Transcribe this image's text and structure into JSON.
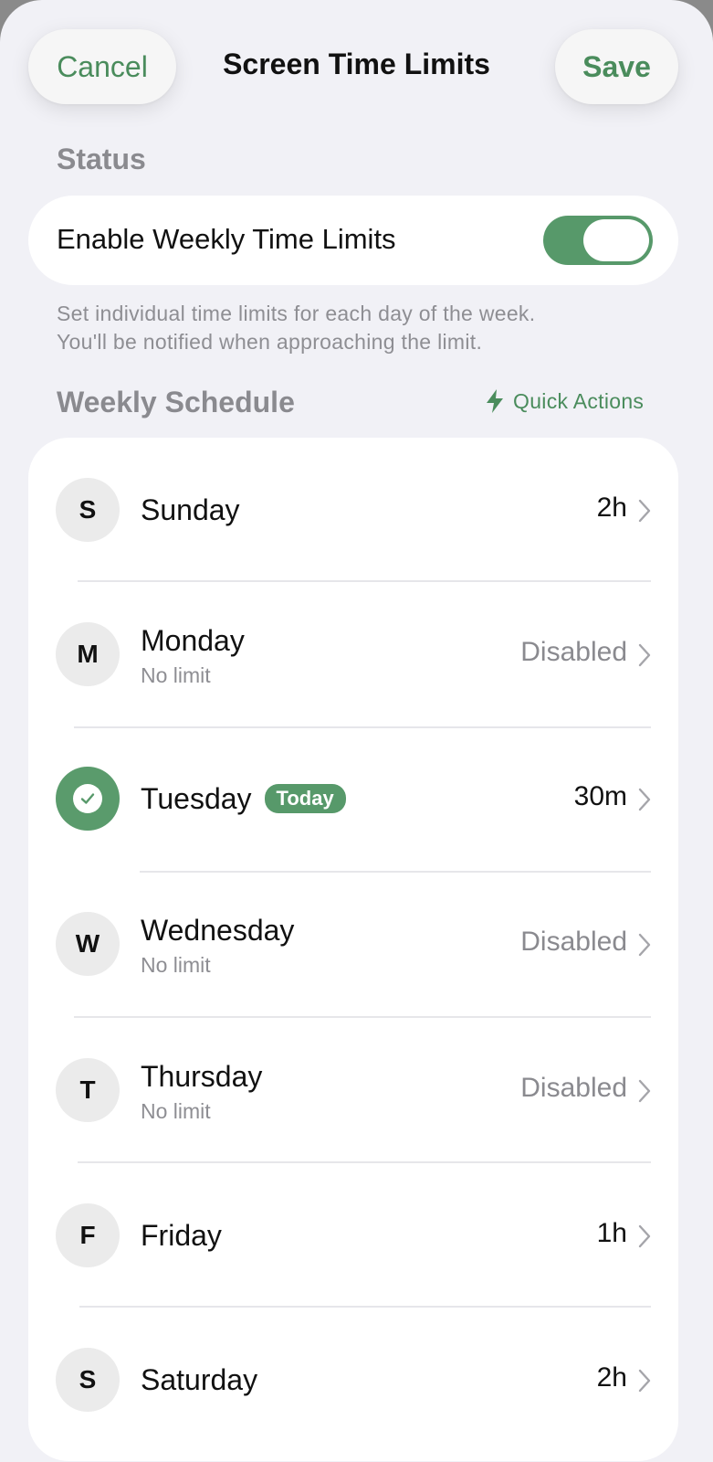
{
  "nav": {
    "cancel_label": "Cancel",
    "title": "Screen Time Limits",
    "save_label": "Save"
  },
  "status": {
    "heading": "Status",
    "toggle_label": "Enable Weekly Time Limits",
    "enabled": true,
    "helper_line1": "Set individual time limits for each day of the week.",
    "helper_line2": "You'll be notified when approaching the limit."
  },
  "schedule": {
    "heading": "Weekly Schedule",
    "quick_actions_label": "Quick Actions",
    "today_badge": "Today",
    "days": [
      {
        "initial": "S",
        "name": "Sunday",
        "sub": "",
        "value": "2h",
        "disabled": false,
        "today": false
      },
      {
        "initial": "M",
        "name": "Monday",
        "sub": "No limit",
        "value": "Disabled",
        "disabled": true,
        "today": false
      },
      {
        "initial": "",
        "name": "Tuesday",
        "sub": "",
        "value": "30m",
        "disabled": false,
        "today": true
      },
      {
        "initial": "W",
        "name": "Wednesday",
        "sub": "No limit",
        "value": "Disabled",
        "disabled": true,
        "today": false
      },
      {
        "initial": "T",
        "name": "Thursday",
        "sub": "No limit",
        "value": "Disabled",
        "disabled": true,
        "today": false
      },
      {
        "initial": "F",
        "name": "Friday",
        "sub": "",
        "value": "1h",
        "disabled": false,
        "today": false
      },
      {
        "initial": "S",
        "name": "Saturday",
        "sub": "",
        "value": "2h",
        "disabled": false,
        "today": false
      }
    ]
  },
  "colors": {
    "accent": "#57996a",
    "accent_text": "#4a8c5c",
    "background": "#f1f1f6",
    "muted": "#8e8e93"
  }
}
